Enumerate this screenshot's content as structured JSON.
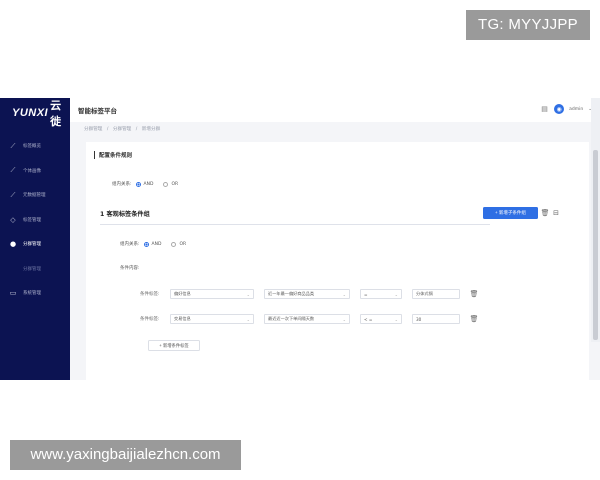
{
  "overlays": {
    "top_right": "TG: MYYJJPP",
    "bottom_left": "www.yaxingbaijialezhcn.com"
  },
  "app": {
    "logo_mark": "YUNXI",
    "logo_text": "云徙",
    "title": "智能标签平台",
    "user": "admin",
    "colors": {
      "sidebar": "#0c1352",
      "accent": "#2f6fe4"
    }
  },
  "sidebar": {
    "items": [
      {
        "label": "标签概览",
        "icon": "chart-icon"
      },
      {
        "label": "个体画像",
        "icon": "user-chart-icon"
      },
      {
        "label": "元数据管理",
        "icon": "database-icon"
      },
      {
        "label": "标签管理",
        "icon": "tag-icon"
      },
      {
        "label": "分群管理",
        "icon": "group-icon",
        "active": true
      },
      {
        "label": "分群管理",
        "sub": true
      },
      {
        "label": "系统管理",
        "icon": "monitor-icon"
      }
    ]
  },
  "breadcrumb": [
    "分群管理",
    "/",
    "分群管理",
    "/",
    "新增分群"
  ],
  "section": {
    "title": "配置条件规则"
  },
  "outer_relation": {
    "label": "组内关系:",
    "options": [
      "AND",
      "OR"
    ],
    "selected": "AND"
  },
  "group": {
    "title": "1 客观标签条件组",
    "add_subgroup": "+ 新增子条件组",
    "relation": {
      "label": "组内关系:",
      "options": [
        "AND",
        "OR"
      ],
      "selected": "AND"
    },
    "content_label": "条件内容:",
    "conditions": [
      {
        "label": "条件标签:",
        "tag": "偏好信息",
        "attr": "近一年最一偏好商品品类",
        "op": "=",
        "value": "分体式锅"
      },
      {
        "label": "条件标签:",
        "tag": "交易信息",
        "attr": "最近近一次下单间隔天数",
        "op": "< =",
        "value": "30"
      }
    ],
    "add_condition": "+ 新增条件标签"
  }
}
